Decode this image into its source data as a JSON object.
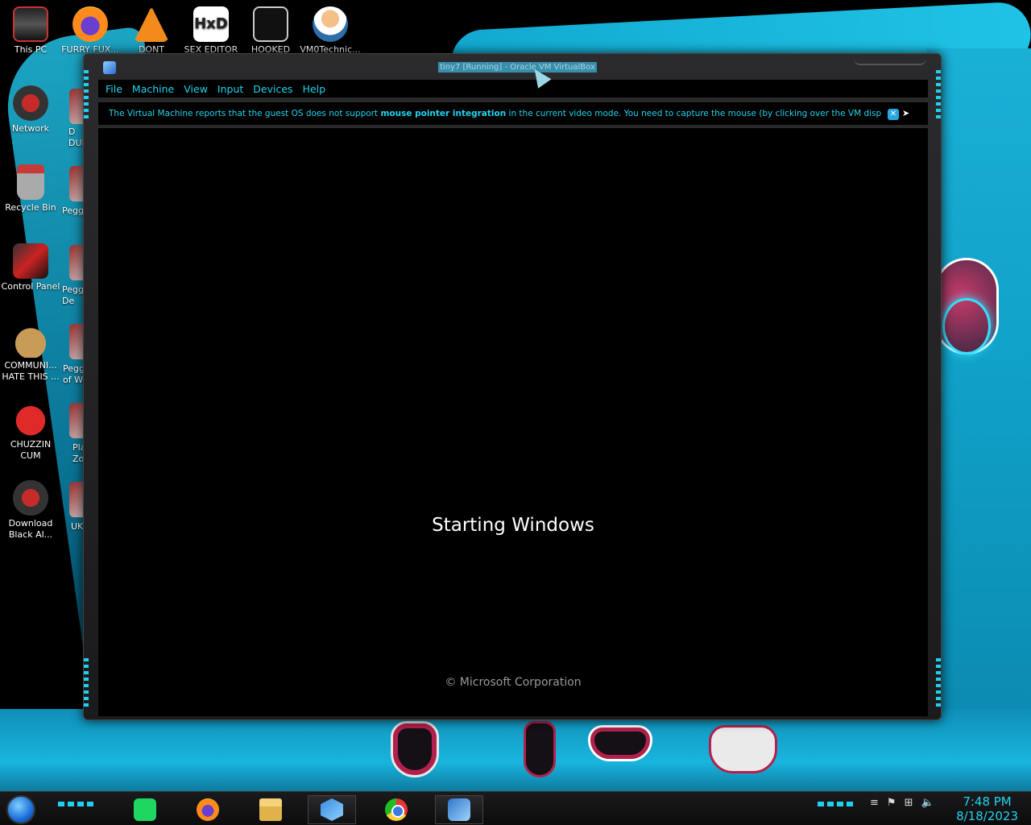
{
  "desktop": {
    "icons": [
      {
        "label": "This PC"
      },
      {
        "label": "FURRY FUX..."
      },
      {
        "label": "DONT STICK..."
      },
      {
        "label": "SEX EDITOR"
      },
      {
        "label": "HOOKED ON..."
      },
      {
        "label": "VM0Technic..."
      },
      {
        "label": "Network"
      },
      {
        "label": "Recycle Bin"
      },
      {
        "label": "Control Panel"
      },
      {
        "label": "COMMUNI...\nHATE THIS ..."
      },
      {
        "label": "CHUZZIN\nCUM"
      },
      {
        "label": "Download\nBlack Al..."
      }
    ],
    "partial_icons": [
      {
        "label": "D\nDUN"
      },
      {
        "label": "Peggle"
      },
      {
        "label": "Peggle\nDe"
      },
      {
        "label": "Peggl\nof Wa"
      },
      {
        "label": "Pla\nZo"
      },
      {
        "label": "UKF"
      }
    ]
  },
  "window": {
    "title": "tiny7 [Running] - Oracle VM VirtualBox",
    "menu": [
      "File",
      "Machine",
      "View",
      "Input",
      "Devices",
      "Help"
    ],
    "notice": {
      "before": "The Virtual Machine reports that the guest OS does not support ",
      "bold": "mouse pointer integration",
      "after": " in the current video mode. You need to capture the mouse (by clicking over the VM display or pressing"
    },
    "vm_screen": {
      "status": "Starting Windows",
      "copyright": "© Microsoft Corporation"
    }
  },
  "taskbar": {
    "apps": [
      {
        "icon": "spotify-icon"
      },
      {
        "icon": "firefox-icon"
      },
      {
        "icon": "file-explorer-icon"
      },
      {
        "icon": "virtualbox-icon"
      },
      {
        "icon": "chrome-icon"
      },
      {
        "icon": "windows7-vm-icon"
      }
    ],
    "clock": {
      "time": "7:48 PM",
      "date": "8/18/2023"
    }
  },
  "colors": {
    "accent": "#22d3ee",
    "vm_bg": "#000000",
    "frame": "#2b2b2e"
  }
}
